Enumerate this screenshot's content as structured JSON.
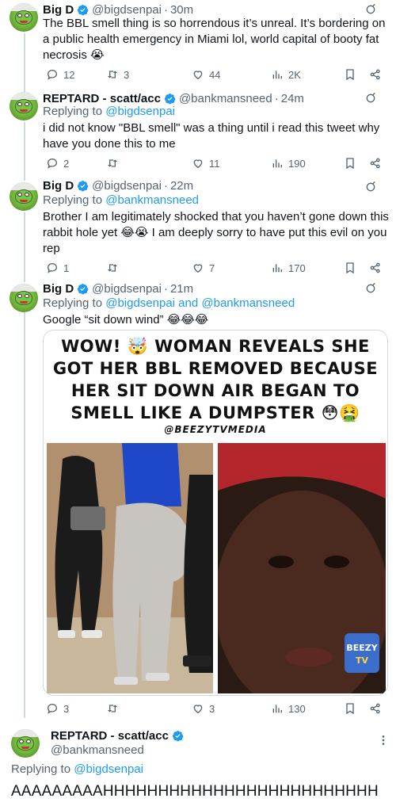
{
  "colors": {
    "link": "#1d9bf0",
    "muted": "#536471",
    "text": "#0f1419",
    "verified": "#1d9bf0"
  },
  "tweets": [
    {
      "name": "Big D",
      "handle": "@bigdsenpai",
      "time": "30m",
      "text": "The BBL smell thing is so horrendous it’s unreal. It’s bordering on a public health emergency in Miami lol, world capital of booty fat necrosis 😭",
      "stats": {
        "replies": "12",
        "retweets": "3",
        "likes": "44",
        "views": "2K"
      }
    },
    {
      "name": "REPTARD - scatt/acc",
      "handle": "@bankmansneed",
      "time": "24m",
      "replying_label": "Replying to",
      "replying_to": "@bigdsenpai",
      "text": "i did not know \"BBL smell\" was a thing until i read this tweet why have you done this to me",
      "stats": {
        "replies": "2",
        "retweets": "",
        "likes": "11",
        "views": "190"
      }
    },
    {
      "name": "Big D",
      "handle": "@bigdsenpai",
      "time": "22m",
      "replying_label": "Replying to",
      "replying_to": "@bankmansneed",
      "text": "Brother I am legitimately shocked that you haven’t gone down this rabbit hole yet 😂😭 I am deeply sorry to have put this evil on you rep",
      "stats": {
        "replies": "1",
        "retweets": "",
        "likes": "7",
        "views": "170"
      }
    },
    {
      "name": "Big D",
      "handle": "@bigdsenpai",
      "time": "21m",
      "replying_label": "Replying to",
      "replying_to": "@bigdsenpai and @bankmansneed",
      "text": "Google “sit down wind” 😂😂😂",
      "stats": {
        "replies": "3",
        "retweets": "",
        "likes": "3",
        "views": "130"
      },
      "image": {
        "headline_1": "WOW! 🤯 WOMAN REVEALS SHE",
        "headline_2": "GOT HER BBL REMOVED BECAUSE",
        "headline_3": "HER SIT DOWN AIR BEGAN TO",
        "headline_4": "SMELL LIKE A DUMPSTER 😳🤮",
        "credit": "@BEEZYTVMEDIA",
        "watermark": "BEEZY TV"
      }
    }
  ],
  "focused": {
    "name": "REPTARD - scatt/acc",
    "handle": "@bankmansneed",
    "replying_label": "Replying to",
    "replying_to": "@bigdsenpai",
    "text": "AAAAAAAAAHHHHHHHHHHHHHHHHHHHHHHHHH"
  },
  "icons": [
    "reply-icon",
    "retweet-icon",
    "like-icon",
    "views-icon",
    "bookmark-icon",
    "share-icon",
    "grok-icon",
    "verified-icon",
    "more-icon"
  ]
}
